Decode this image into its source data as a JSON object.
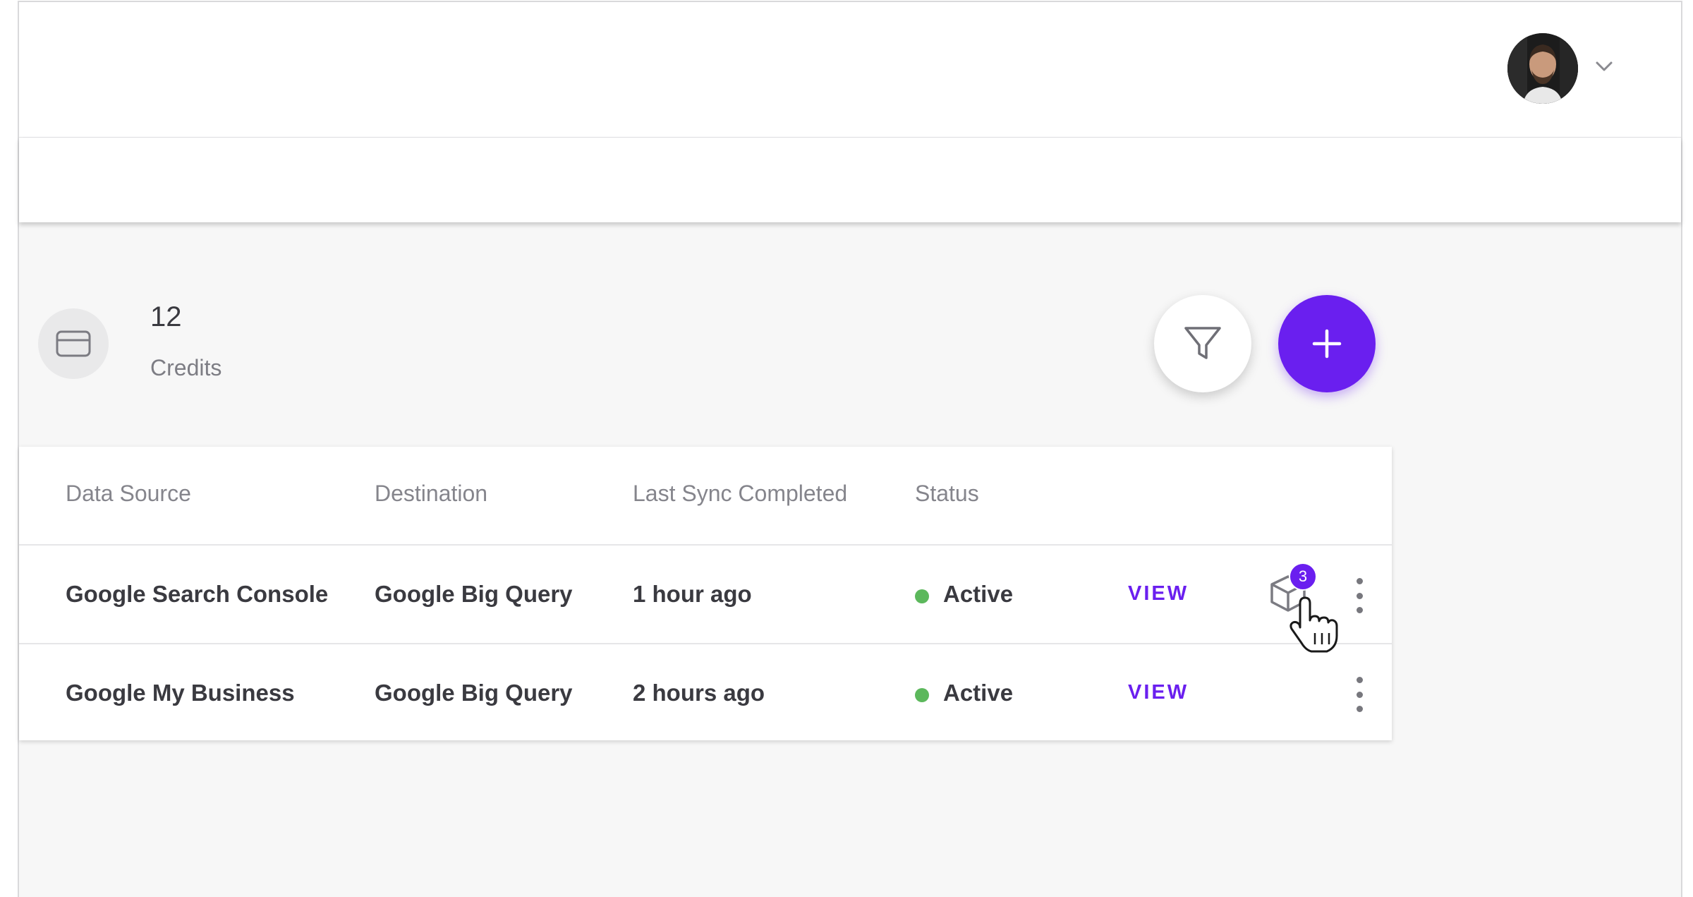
{
  "header": {
    "user_menu": {
      "avatar_icon": "user-avatar",
      "chevron_icon": "chevron-down-icon"
    }
  },
  "summary": {
    "credits_icon": "credit-card-icon",
    "credits_count": "12",
    "credits_label": "Credits"
  },
  "actions": {
    "filter_icon": "filter-icon",
    "add_icon": "plus-icon",
    "accent_color": "#6a1fef"
  },
  "table": {
    "columns": [
      "Data Source",
      "Destination",
      "Last Sync Completed",
      "Status"
    ],
    "rows": [
      {
        "data_source": "Google Search Console",
        "destination": "Google Big Query",
        "last_sync": "1 hour ago",
        "status": "Active",
        "status_color": "#5cb85c",
        "action": "VIEW",
        "notification_count": "3"
      },
      {
        "data_source": "Google My Business",
        "destination": "Google Big Query",
        "last_sync": "2 hours ago",
        "status": "Active",
        "status_color": "#5cb85c",
        "action": "VIEW"
      }
    ]
  }
}
